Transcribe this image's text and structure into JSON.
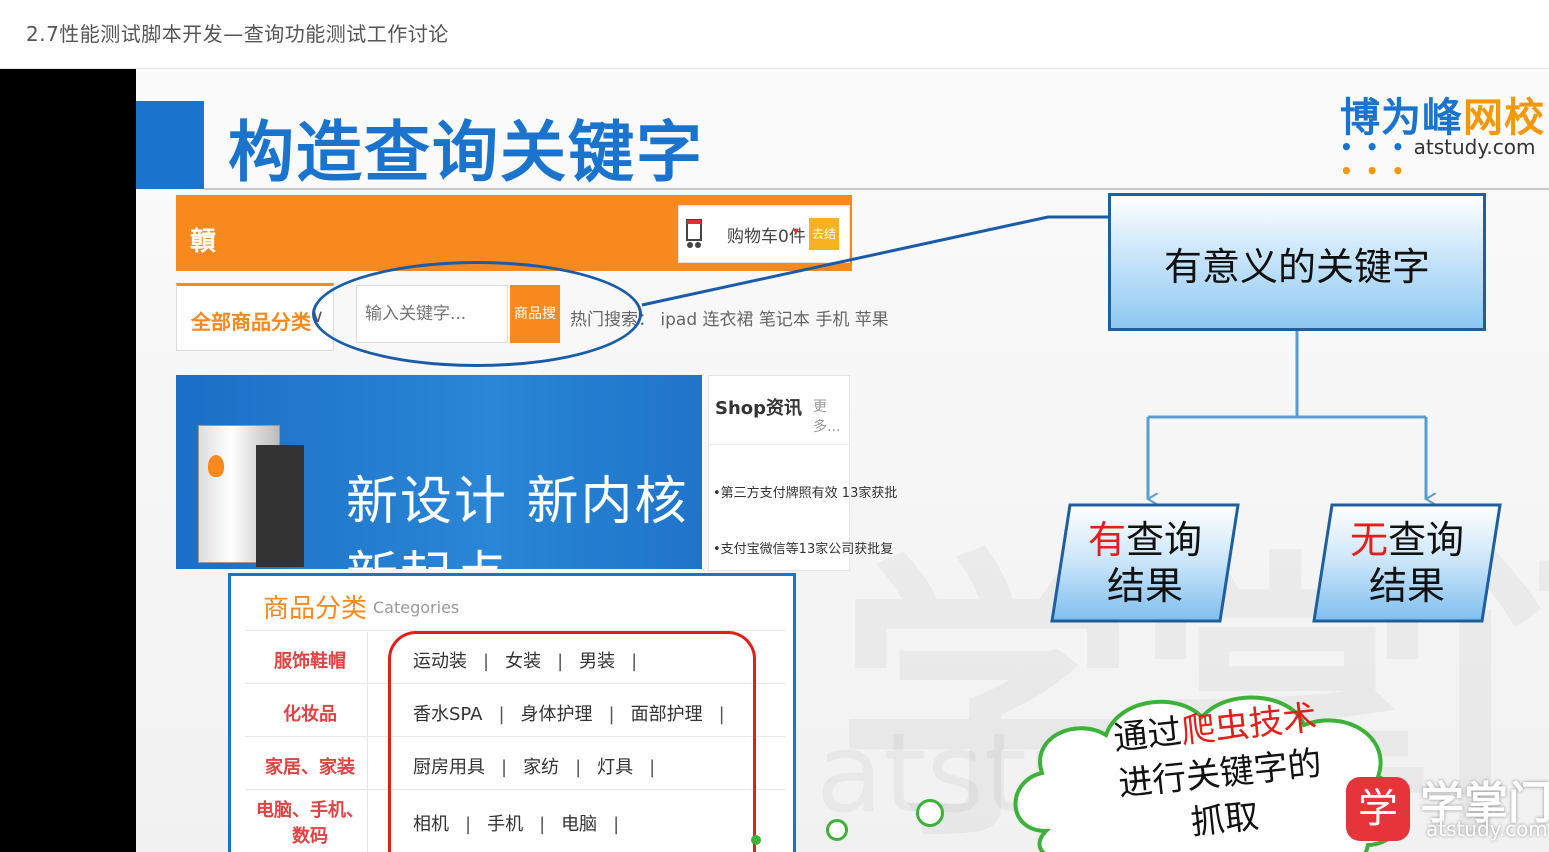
{
  "page": {
    "lesson_title": "2.7性能测试脚本开发—查询功能测试工作讨论"
  },
  "slide": {
    "title": "构造查询关键字",
    "brand": {
      "name_part1": "博为峰",
      "name_part2": "网校",
      "dots_left": "• • •",
      "url": "atstudy.com",
      "dots_right": "• • •"
    },
    "background_watermark": "学掌门",
    "background_watermark2": "atstudy"
  },
  "shop": {
    "logo": "贑",
    "cart_label": "购物车0件",
    "cart_arrow": "▾",
    "checkout_label": "去结算",
    "category_dropdown": "全部商品分类",
    "dropdown_arrow": "∨",
    "search_placeholder": "输入关键字...",
    "search_button": "商品搜索",
    "hot_keywords": "热门搜索： ipad  连衣裙  笔记本  手机  苹果",
    "banner_text": "新设计 新内核 新起点",
    "news_title": "Shop资讯",
    "news_more": "更多...",
    "news_item1": "•第三方支付牌照有效 13家获批",
    "news_item2": "•支付宝微信等13家公司获批复",
    "category_panel": {
      "title": "商品分类",
      "subtitle": "Categories",
      "rows": [
        {
          "name": "服饰鞋帽",
          "items": [
            "运动装",
            "女装",
            "男装"
          ]
        },
        {
          "name": "化妆品",
          "items": [
            "香水SPA",
            "身体护理",
            "面部护理"
          ]
        },
        {
          "name": "家居、家装",
          "items": [
            "厨房用具",
            "家纺",
            "灯具"
          ]
        },
        {
          "name": "电脑、手机、数码",
          "items": [
            "相机",
            "手机",
            "电脑"
          ]
        }
      ]
    }
  },
  "diagram": {
    "top_box": "有意义的关键字",
    "left_box": {
      "prefix": "有",
      "rest1": "查询",
      "line2": "结果"
    },
    "right_box": {
      "prefix": "无",
      "rest1": "查询",
      "line2": "结果"
    },
    "cloud": {
      "line1_a": "通过",
      "line1_b": "爬虫技术",
      "line2": "进行关键字的",
      "line3": "抓取"
    },
    "colors": {
      "blue": "#1a73cc",
      "orange": "#f7891f",
      "red": "#e0201b",
      "green": "#3db13a"
    }
  },
  "watermark": {
    "logo_char": "学",
    "name": "学掌门",
    "url": "atstudy.com"
  }
}
